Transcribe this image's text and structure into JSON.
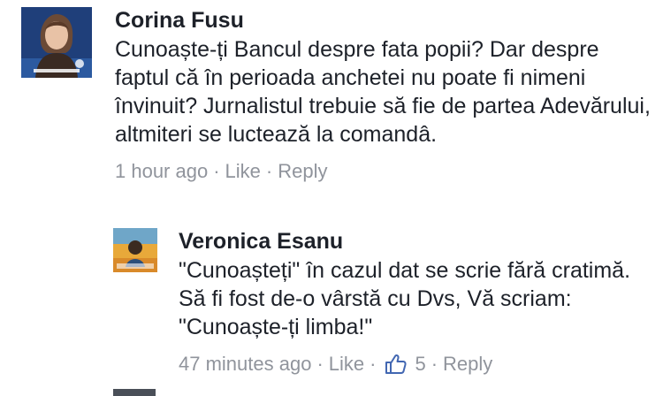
{
  "comments": [
    {
      "author": "Corina Fusu",
      "text": "Cunoaște-ți Bancul despre fata popii? Dar despre faptul că în perioada anchetei nu poate fi nimeni învinuit? Jurnalistul trebuie să fie de partea Adevărului, altmiteri se luctează la comandâ.",
      "time": "1 hour ago",
      "like_label": "Like",
      "reply_label": "Reply",
      "separator": "·",
      "avatar_icon": "profile-photo-woman"
    },
    {
      "author": "Veronica Esanu",
      "text": "\"Cunoașteți\" în cazul dat se scrie fără cratimă. Să fi fost de-o vârstă cu Dvs, Vă scriam: \"Cunoaște-ți limba!\"",
      "time": "47 minutes ago",
      "like_label": "Like",
      "like_count": "5",
      "reply_label": "Reply",
      "separator": "·",
      "like_icon": "thumbs-up-icon",
      "avatar_icon": "profile-photo-illustration"
    }
  ],
  "colors": {
    "text": "#1d2129",
    "meta": "#90949c",
    "like_blue": "#4267b2"
  }
}
